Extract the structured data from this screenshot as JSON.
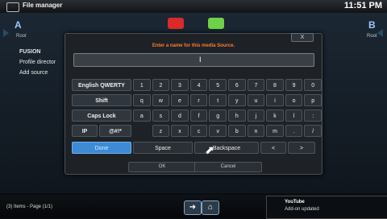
{
  "header": {
    "title": "File manager",
    "clock": "11:51 PM"
  },
  "left_pane": {
    "letter": "A",
    "sub": "Root",
    "items": [
      "FUSION",
      "Profile director",
      "Add source"
    ]
  },
  "right_pane": {
    "letter": "B",
    "sub": "Root"
  },
  "dialog": {
    "title": "Enter a name for this media Source.",
    "close_label": "X",
    "input_value": "",
    "cursor": "I",
    "rows": [
      [
        "English QWERTY",
        "1",
        "2",
        "3",
        "4",
        "5",
        "6",
        "7",
        "8",
        "9",
        "0"
      ],
      [
        "Shift",
        "q",
        "w",
        "e",
        "r",
        "t",
        "y",
        "u",
        "i",
        "o",
        "p"
      ],
      [
        "Caps Lock",
        "a",
        "s",
        "d",
        "f",
        "g",
        "h",
        "j",
        "k",
        "l",
        ":"
      ],
      [
        "IP",
        "@#!*",
        "z",
        "x",
        "c",
        "v",
        "b",
        "n",
        "m",
        ".",
        "/"
      ]
    ],
    "bottom_row": {
      "done": "Done",
      "space": "Space",
      "backspace": "Backspace",
      "left": "<",
      "right": ">"
    },
    "ok": "OK",
    "cancel": "Cancel"
  },
  "footer": {
    "items": "(3) Items - Page (1/1)",
    "back_icon": "back-arrow-icon",
    "home_icon": "home-icon"
  },
  "notification": {
    "title": "YouTube",
    "message": "Add-on updated"
  },
  "colors": {
    "accent": "#3d8bd6",
    "title": "#ff7a2e",
    "red_btn": "#d92b2b",
    "green_btn": "#6fd14a"
  }
}
